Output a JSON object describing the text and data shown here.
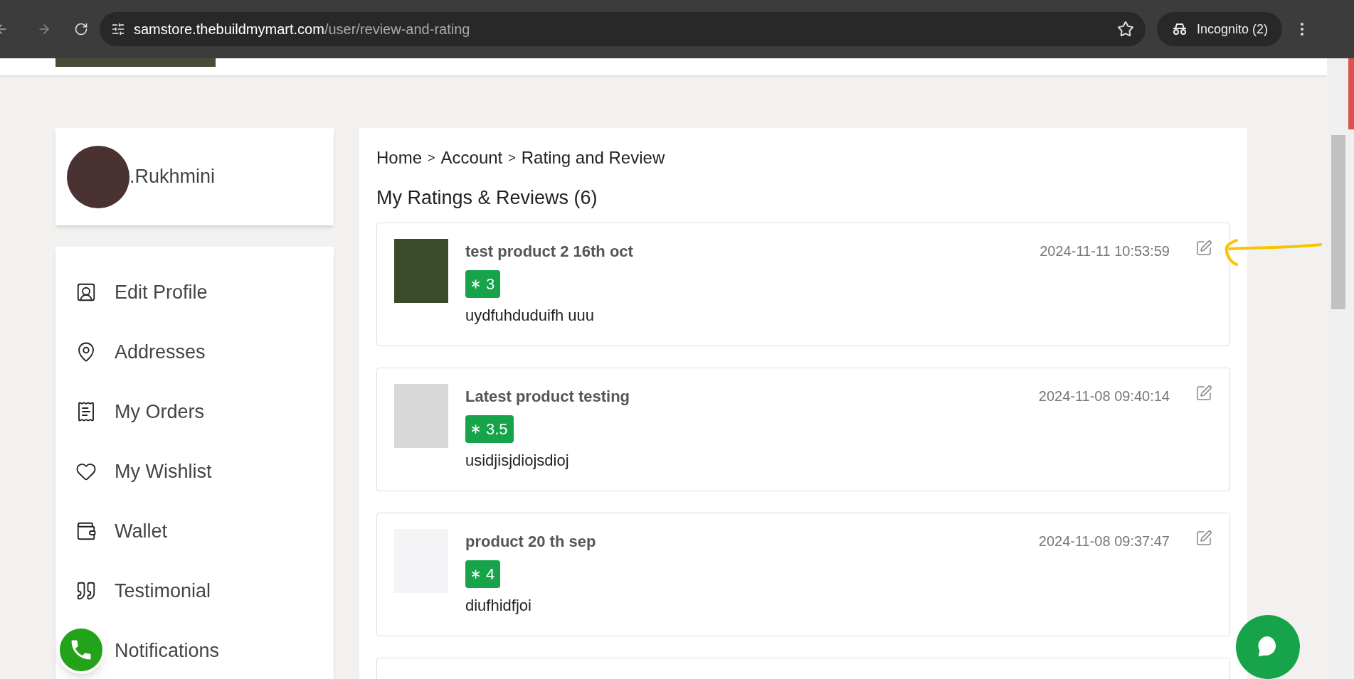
{
  "browser": {
    "url_host": "samstore.thebuildmymart.com",
    "url_path": "/user/review-and-rating",
    "incognito_label": "Incognito (2)"
  },
  "profile": {
    "name": ".Rukhmini"
  },
  "menu": [
    {
      "kind": "profile",
      "label": "Edit Profile"
    },
    {
      "kind": "address",
      "label": "Addresses"
    },
    {
      "kind": "orders",
      "label": "My Orders"
    },
    {
      "kind": "wishlist",
      "label": "My Wishlist"
    },
    {
      "kind": "wallet",
      "label": "Wallet"
    },
    {
      "kind": "testimonial",
      "label": "Testimonial"
    },
    {
      "kind": "notifications",
      "label": "Notifications"
    }
  ],
  "breadcrumb": [
    "Home",
    "Account",
    "Rating and Review"
  ],
  "breadcrumb_separator": ">",
  "heading": "My Ratings & Reviews (6)",
  "reviews": [
    {
      "kind": "herbs",
      "title": "test product 2 16th oct",
      "rating": "3",
      "text": "uydfuhduduifh uuu",
      "date": "2024-11-11 10:53:59",
      "annotated": true
    },
    {
      "kind": "people",
      "title": "Latest product testing",
      "rating": "3.5",
      "text": "usidjisjdiojsdioj",
      "date": "2024-11-08 09:40:14",
      "annotated": false
    },
    {
      "kind": "sketch",
      "title": "product 20 th sep",
      "rating": "4",
      "text": "diufhidfjoi",
      "date": "2024-11-08 09:37:47",
      "annotated": false
    }
  ]
}
